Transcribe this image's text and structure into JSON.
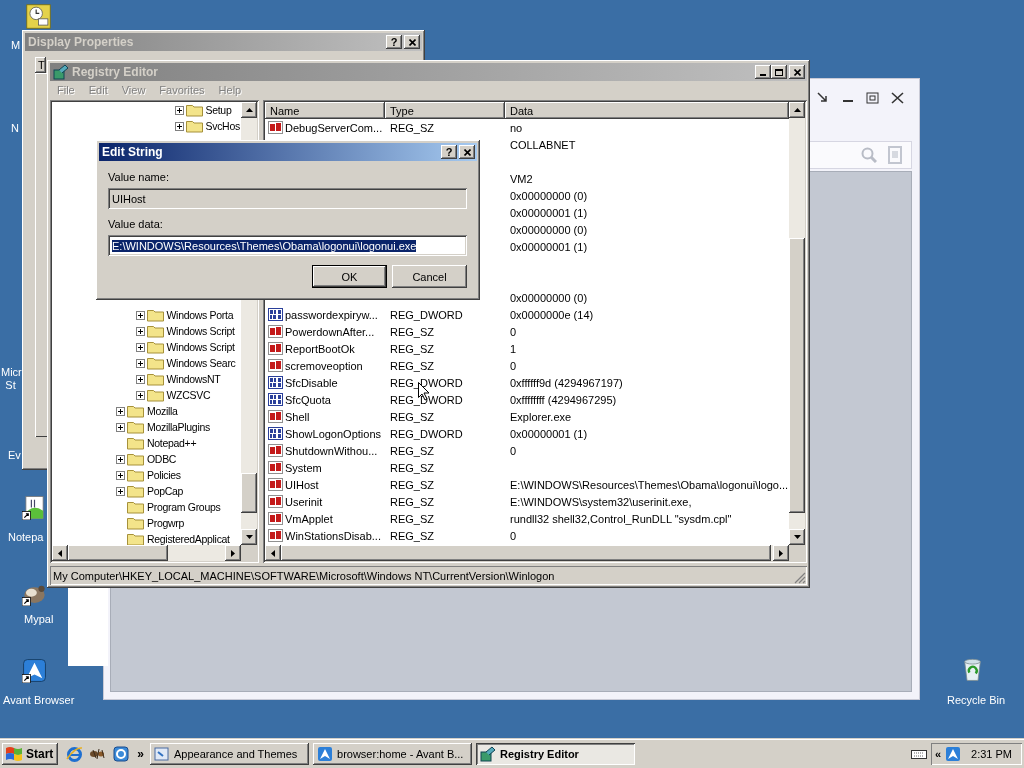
{
  "desktop_icons": [
    {
      "kind": "clock",
      "label_lines": [
        "M"
      ]
    },
    {
      "label_lines": [
        "N"
      ]
    },
    {
      "label_lines": [
        "Micr",
        "St"
      ]
    },
    {
      "label_lines": [
        "Ev"
      ]
    },
    {
      "kind": "notepad",
      "shortcut": true,
      "label_lines": [
        "Notepa"
      ]
    },
    {
      "kind": "mypal",
      "shortcut": true,
      "label_lines": [
        "Mypal"
      ]
    },
    {
      "kind": "avant",
      "shortcut": true,
      "label_lines": [
        "Avant Browser"
      ]
    },
    {
      "kind": "recycle",
      "shortcut": false,
      "label_lines": [
        "Recycle Bin"
      ]
    }
  ],
  "display_properties": {
    "title": "Display Properties",
    "active": false,
    "help": "?",
    "tab": "T"
  },
  "registry_editor": {
    "title": "Registry Editor",
    "active": false,
    "menu": [
      "File",
      "Edit",
      "View",
      "Favorites",
      "Help"
    ],
    "menu_disabled": true,
    "tree": {
      "upper": [
        {
          "children": [
            {
              "children": [
                {
                  "children": [
                    {
                      "label": "Setup",
                      "expandable": true
                    },
                    {
                      "label": "SvcHos",
                      "expandable": true
                    }
                  ]
                }
              ]
            }
          ]
        }
      ],
      "lower": [
        {
          "children": [
            {
              "label": "Windows Porta",
              "expandable": true
            },
            {
              "label": "Windows Script",
              "expandable": true
            },
            {
              "label": "Windows Script",
              "expandable": true
            },
            {
              "label": "Windows Searc",
              "expandable": true
            },
            {
              "label": "WindowsNT",
              "expandable": true
            },
            {
              "label": "WZCSVC",
              "expandable": true
            }
          ]
        },
        {
          "label": "Mozilla",
          "expandable": true
        },
        {
          "label": "MozillaPlugins",
          "expandable": true
        },
        {
          "label": "Notepad++",
          "expandable": false
        },
        {
          "label": "ODBC",
          "expandable": true
        },
        {
          "label": "Policies",
          "expandable": true
        },
        {
          "label": "PopCap",
          "expandable": true
        },
        {
          "label": "Program Groups",
          "expandable": false
        },
        {
          "label": "Progwrp",
          "expandable": false
        },
        {
          "label": "RegisteredApplicat",
          "expandable": false
        }
      ]
    },
    "list": {
      "columns": [
        "Name",
        "Type",
        "Data"
      ],
      "rows": [
        {
          "kind": "sz",
          "name": "DebugServerCom...",
          "type": "REG_SZ",
          "data": "no"
        },
        {
          "data": "COLLABNET"
        },
        {},
        {
          "data": "VM2"
        },
        {
          "data": "0x00000000 (0)"
        },
        {
          "data": "0x00000001 (1)"
        },
        {
          "data": "0x00000000 (0)"
        },
        {
          "data": "0x00000001 (1)"
        },
        {},
        {},
        {
          "data": "0x00000000 (0)"
        },
        {
          "kind": "dword",
          "name": "passwordexpiryw...",
          "type": "REG_DWORD",
          "data": "0x0000000e (14)"
        },
        {
          "kind": "sz",
          "name": "PowerdownAfter...",
          "type": "REG_SZ",
          "data": "0"
        },
        {
          "kind": "sz",
          "name": "ReportBootOk",
          "type": "REG_SZ",
          "data": "1"
        },
        {
          "kind": "sz",
          "name": "scremoveoption",
          "type": "REG_SZ",
          "data": "0"
        },
        {
          "kind": "dword",
          "name": "SfcDisable",
          "type": "REG_DWORD",
          "data": "0xffffff9d (4294967197)"
        },
        {
          "kind": "dword",
          "name": "SfcQuota",
          "type": "REG_DWORD",
          "data": "0xffffffff (4294967295)"
        },
        {
          "kind": "sz",
          "name": "Shell",
          "type": "REG_SZ",
          "data": "Explorer.exe"
        },
        {
          "kind": "dword",
          "name": "ShowLogonOptions",
          "type": "REG_DWORD",
          "data": "0x00000001 (1)"
        },
        {
          "kind": "sz",
          "name": "ShutdownWithou...",
          "type": "REG_SZ",
          "data": "0"
        },
        {
          "kind": "sz",
          "name": "System",
          "type": "REG_SZ"
        },
        {
          "kind": "sz",
          "name": "UIHost",
          "type": "REG_SZ",
          "data": "E:\\WINDOWS\\Resources\\Themes\\Obama\\logonui\\logo..."
        },
        {
          "kind": "sz",
          "name": "Userinit",
          "type": "REG_SZ",
          "data": "E:\\WINDOWS\\system32\\userinit.exe,"
        },
        {
          "kind": "sz",
          "name": "VmApplet",
          "type": "REG_SZ",
          "data": "rundll32 shell32,Control_RunDLL \"sysdm.cpl\""
        },
        {
          "kind": "sz",
          "name": "WinStationsDisab...",
          "type": "REG_SZ",
          "data": "0"
        }
      ]
    },
    "status_bar": "My Computer\\HKEY_LOCAL_MACHINE\\SOFTWARE\\Microsoft\\Windows NT\\CurrentVersion\\Winlogon"
  },
  "edit_string": {
    "title": "Edit String",
    "active": true,
    "help": "?",
    "value_name_label": "Value name:",
    "value_name": "UIHost",
    "value_data_label": "Value data:",
    "value_data": "E:\\WINDOWS\\Resources\\Themes\\Obama\\logonui\\logonui.exe",
    "value_data_selected": true,
    "buttons": [
      {
        "label": "OK",
        "default": true
      },
      {
        "label": "Cancel",
        "default": false
      }
    ]
  },
  "taskbar": {
    "start": "Start",
    "more": "»",
    "tasks": [
      {
        "kind": "control-panel",
        "label": "Appearance and Themes",
        "selected": false
      },
      {
        "kind": "browser",
        "label": "browser:home - Avant B...",
        "selected": false
      },
      {
        "kind": "registry",
        "label": "Registry Editor",
        "selected": true
      }
    ],
    "tray_expand": "«",
    "clock": "2:31 PM"
  }
}
